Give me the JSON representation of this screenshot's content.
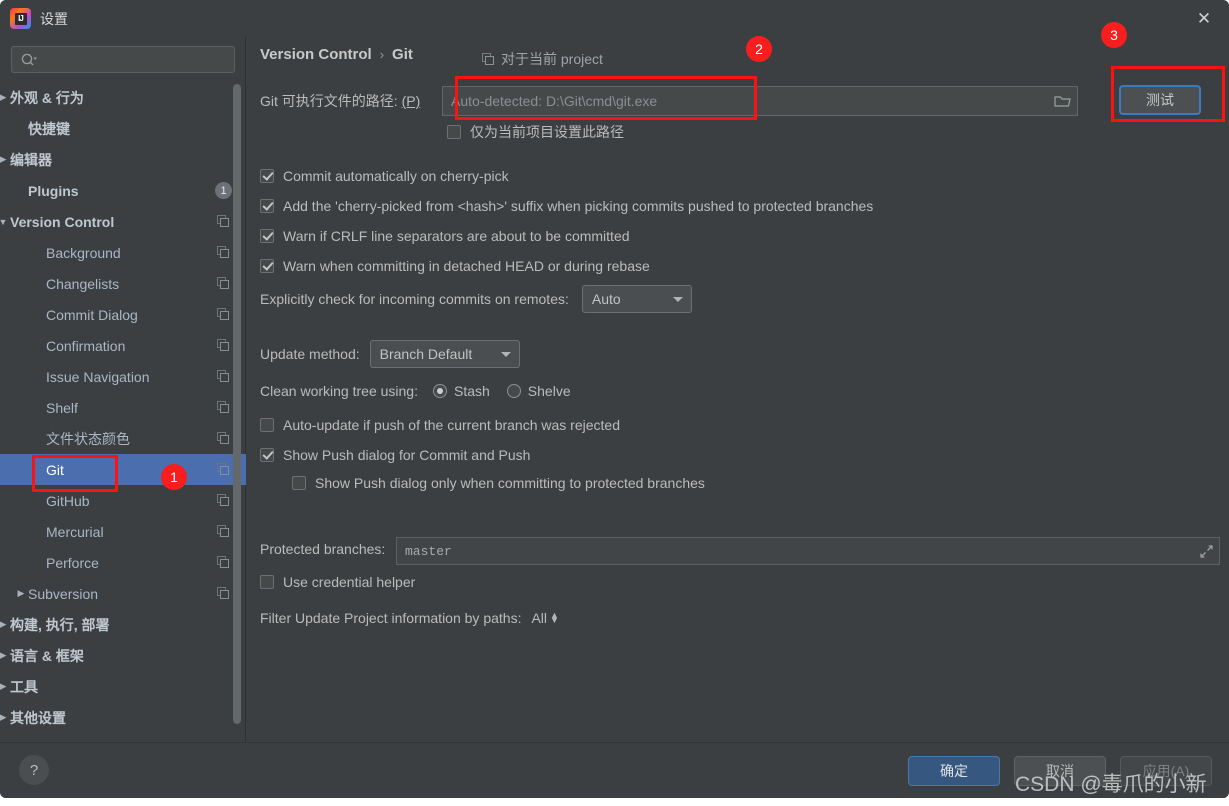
{
  "window": {
    "title": "设置",
    "logo_icon": "intellij-idea-logo",
    "close_icon": "close-icon"
  },
  "sidebar": {
    "search": {
      "value": "",
      "placeholder": "",
      "icon": "search-icon"
    },
    "items": [
      {
        "label": "外观 & 行为",
        "twisty": "▶",
        "bold": true,
        "indent": 10,
        "copy": false
      },
      {
        "label": "快捷键",
        "twisty": "",
        "bold": true,
        "indent": 28,
        "copy": false
      },
      {
        "label": "编辑器",
        "twisty": "▶",
        "bold": true,
        "indent": 10,
        "copy": false
      },
      {
        "label": "Plugins",
        "twisty": "",
        "bold": true,
        "indent": 28,
        "copy": false,
        "badge": "1"
      },
      {
        "label": "Version Control",
        "twisty": "▼",
        "bold": true,
        "indent": 10,
        "copy": true
      },
      {
        "label": "Background",
        "twisty": "",
        "bold": false,
        "indent": 46,
        "copy": true
      },
      {
        "label": "Changelists",
        "twisty": "",
        "bold": false,
        "indent": 46,
        "copy": true
      },
      {
        "label": "Commit Dialog",
        "twisty": "",
        "bold": false,
        "indent": 46,
        "copy": true
      },
      {
        "label": "Confirmation",
        "twisty": "",
        "bold": false,
        "indent": 46,
        "copy": true
      },
      {
        "label": "Issue Navigation",
        "twisty": "",
        "bold": false,
        "indent": 46,
        "copy": true
      },
      {
        "label": "Shelf",
        "twisty": "",
        "bold": false,
        "indent": 46,
        "copy": true
      },
      {
        "label": "文件状态颜色",
        "twisty": "",
        "bold": false,
        "indent": 46,
        "copy": true
      },
      {
        "label": "Git",
        "twisty": "",
        "bold": false,
        "indent": 46,
        "copy": true,
        "selected": true
      },
      {
        "label": "GitHub",
        "twisty": "",
        "bold": false,
        "indent": 46,
        "copy": true
      },
      {
        "label": "Mercurial",
        "twisty": "",
        "bold": false,
        "indent": 46,
        "copy": true
      },
      {
        "label": "Perforce",
        "twisty": "",
        "bold": false,
        "indent": 46,
        "copy": true
      },
      {
        "label": "Subversion",
        "twisty": "▶",
        "bold": false,
        "indent": 28,
        "copy": true
      },
      {
        "label": "构建, 执行, 部署",
        "twisty": "▶",
        "bold": true,
        "indent": 10,
        "copy": false
      },
      {
        "label": "语言 & 框架",
        "twisty": "▶",
        "bold": true,
        "indent": 10,
        "copy": false
      },
      {
        "label": "工具",
        "twisty": "▶",
        "bold": true,
        "indent": 10,
        "copy": false
      },
      {
        "label": "其他设置",
        "twisty": "▶",
        "bold": true,
        "indent": 10,
        "copy": false
      }
    ]
  },
  "content": {
    "breadcrumb": {
      "parent": "Version Control",
      "separator": "›",
      "current": "Git"
    },
    "for_project": {
      "label": "对于当前 project",
      "icon": "copy-settings-icon"
    },
    "git_path": {
      "label": "Git 可执行文件的路径:",
      "mnemonic": "(P)",
      "value": "",
      "placeholder": "Auto-detected: D:\\Git\\cmd\\git.exe",
      "browse_icon": "folder-icon"
    },
    "test_button": "测试",
    "project_only_checkbox": {
      "label": "仅为当前项目设置此路径",
      "checked": false
    },
    "checkboxes": [
      {
        "label": "Commit automatically on cherry-pick",
        "checked": true
      },
      {
        "label": "Add the 'cherry-picked from <hash>' suffix when picking commits pushed to protected branches",
        "checked": true
      },
      {
        "label": "Warn if CRLF line separators are about to be committed",
        "checked": true
      },
      {
        "label": "Warn when committing in detached HEAD or during rebase",
        "checked": true
      }
    ],
    "incoming_commits": {
      "label": "Explicitly check for incoming commits on remotes:",
      "value": "Auto"
    },
    "update_method": {
      "label": "Update method:",
      "value": "Branch Default"
    },
    "clean_working_tree": {
      "label": "Clean working tree using:",
      "options": [
        {
          "label": "Stash",
          "selected": true
        },
        {
          "label": "Shelve",
          "selected": false
        }
      ]
    },
    "auto_update": {
      "label": "Auto-update if push of the current branch was rejected",
      "checked": false
    },
    "show_push_dialog": {
      "label": "Show Push dialog for Commit and Push",
      "checked": true
    },
    "show_push_dialog_protected": {
      "label": "Show Push dialog only when committing to protected branches",
      "checked": false
    },
    "protected_branches": {
      "label": "Protected branches:",
      "value": "master",
      "expand_icon": "expand-icon"
    },
    "use_credential_helper": {
      "label": "Use credential helper",
      "checked": false
    },
    "filter_update": {
      "label": "Filter Update Project information by paths:",
      "value": "All"
    }
  },
  "footer": {
    "help_icon": "?",
    "ok": "确定",
    "cancel": "取消",
    "apply": "应用(A)"
  },
  "annotations": {
    "badge1": "1",
    "badge2": "2",
    "badge3": "3",
    "color": "#f81e1e"
  },
  "watermark": "CSDN @毒爪的小新"
}
